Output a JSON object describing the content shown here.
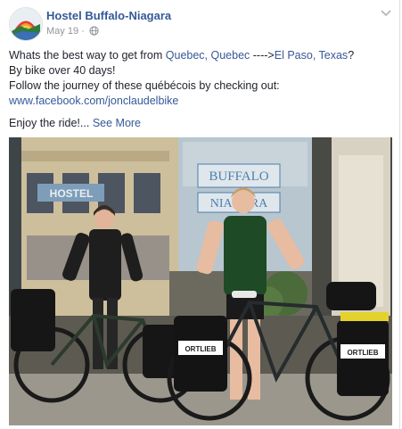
{
  "post": {
    "page_name": "Hostel Buffalo-Niagara",
    "date": "May 19",
    "separator": "·",
    "line1_prefix": "Whats the best way to get from ",
    "line1_link1": "Quebec, Quebec",
    "line1_arrow": " ---->",
    "line1_link2": "El Paso, Texas",
    "line1_suffix": "?",
    "line2": "By bike over 40 days!",
    "line3": "Follow the journey of these québécois by checking out:",
    "url": "www.facebook.com/jonclaudelbike",
    "enjoy": "Enjoy the ride!...",
    "see_more": "See More"
  },
  "photo": {
    "window_sign_line1": "BUFFALO",
    "window_sign_line2": "NIAGARA",
    "left_window_text": "HOSTEL",
    "bag_brand": "ORTLIEB"
  },
  "colors": {
    "link": "#365899",
    "meta": "#90949c",
    "text": "#1d2129"
  }
}
